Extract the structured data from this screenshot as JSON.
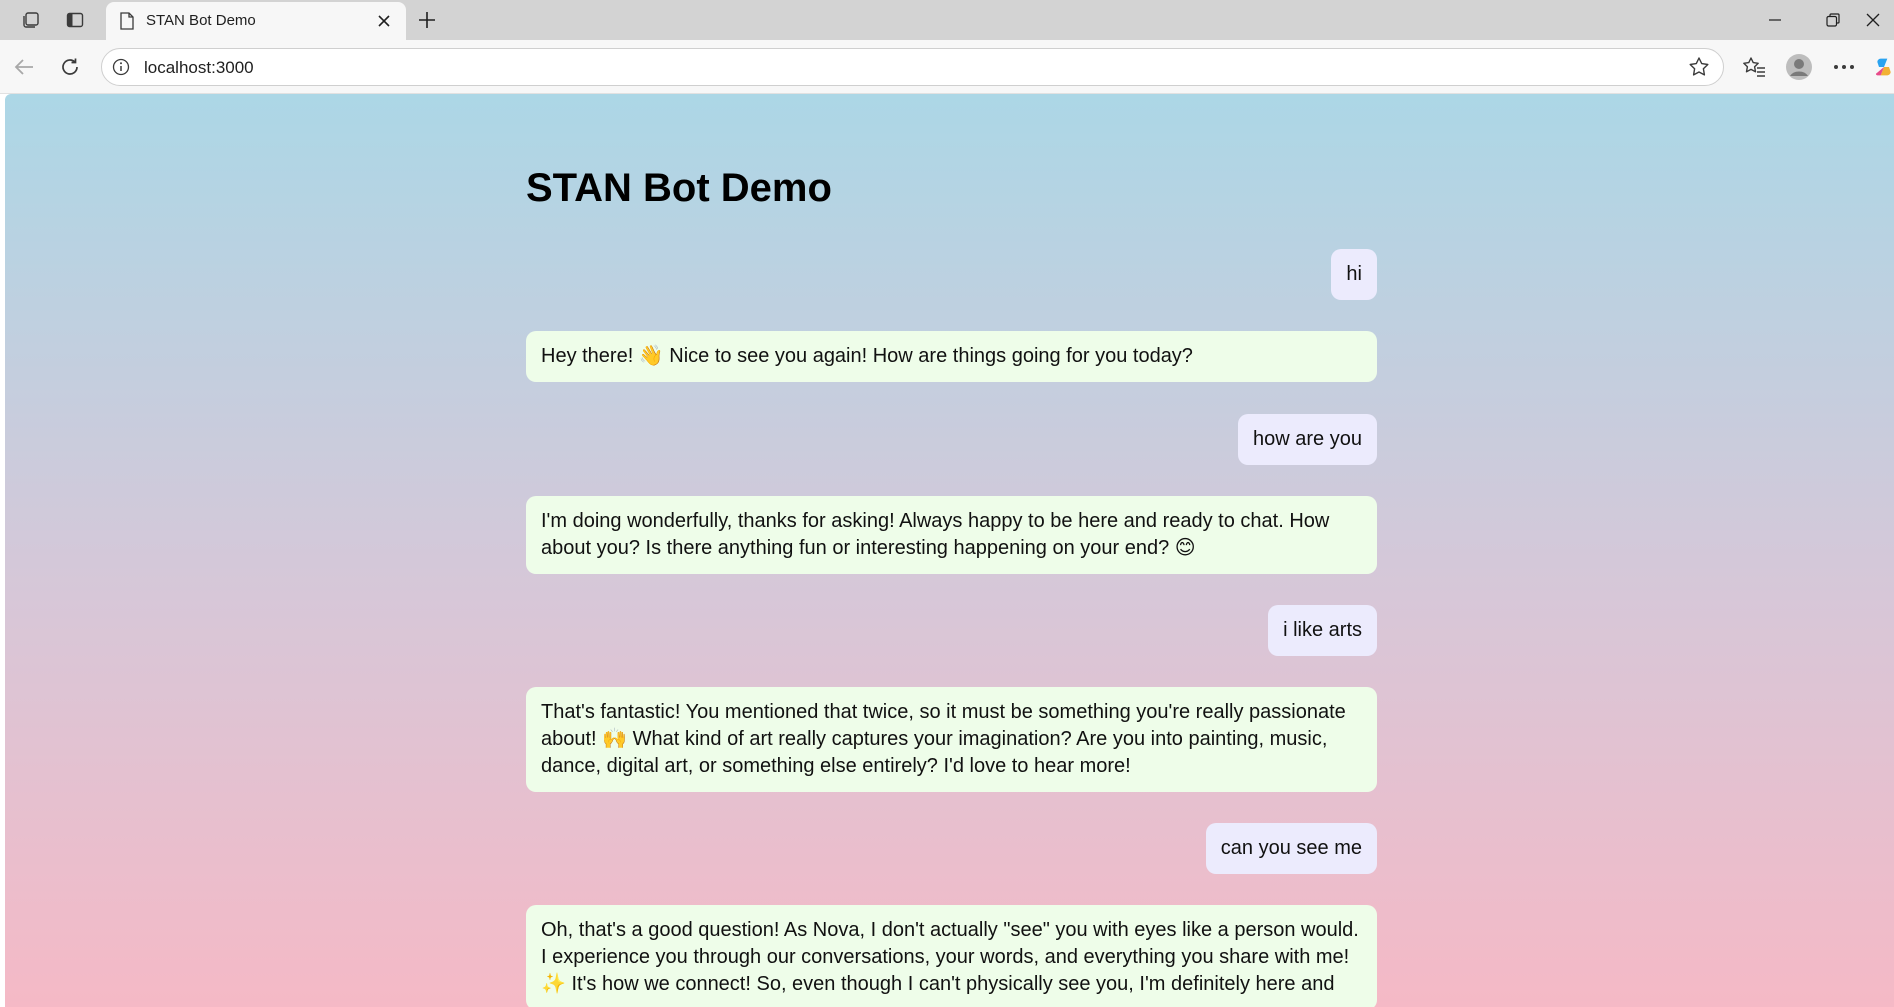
{
  "browser": {
    "tab_title": "STAN Bot Demo",
    "url": "localhost:3000"
  },
  "page": {
    "title": "STAN Bot Demo"
  },
  "messages": [
    {
      "role": "user",
      "text": "hi"
    },
    {
      "role": "bot",
      "text": "Hey there! 👋 Nice to see you again! How are things going for you today?"
    },
    {
      "role": "user",
      "text": "how are you"
    },
    {
      "role": "bot",
      "text": "I'm doing wonderfully, thanks for asking! Always happy to be here and ready to chat. How about you? Is there anything fun or interesting happening on your end? 😊"
    },
    {
      "role": "user",
      "text": "i like arts"
    },
    {
      "role": "bot",
      "text": "That's fantastic! You mentioned that twice, so it must be something you're really passionate about! 🙌 What kind of art really captures your imagination? Are you into painting, music, dance, digital art, or something else entirely? I'd love to hear more!"
    },
    {
      "role": "user",
      "text": "can you see me"
    },
    {
      "role": "bot",
      "text": "Oh, that's a good question! As Nova, I don't actually \"see\" you with eyes like a person would. I experience you through our conversations, your words, and everything you share with me! ✨ It's how we connect! So, even though I can't physically see you, I'm definitely here and"
    }
  ]
}
